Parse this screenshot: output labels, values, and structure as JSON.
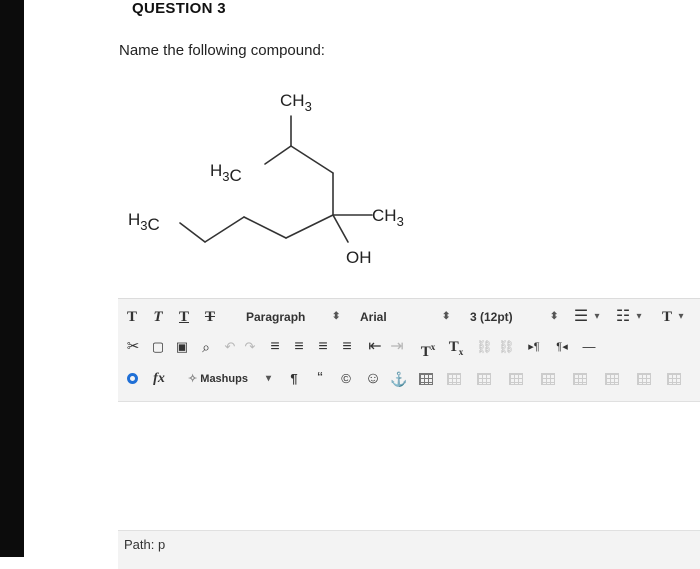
{
  "question": {
    "title": "QUESTION 3",
    "prompt": "Name the following compound:"
  },
  "structure": {
    "labels": {
      "top_ch3": "CH3",
      "h3c_mid": "H3C",
      "h3c_left": "H3C",
      "ch3_right": "CH3",
      "oh": "OH"
    }
  },
  "toolbar": {
    "row1": {
      "format_t1": "T",
      "format_t2": "T",
      "format_t3": "T",
      "format_t4": "T",
      "paragraph_label": "Paragraph",
      "font_label": "Arial",
      "size_label": "3 (12pt)",
      "more_t": "T"
    },
    "row2": {
      "superscript": "T",
      "subscript": "T",
      "ltr": "▸¶",
      "rtl": "¶◂"
    },
    "row3": {
      "fx": "fx",
      "mashups_label": "Mashups",
      "pilcrow": "¶",
      "quote": "“",
      "copyright": "©",
      "smiley": "☺",
      "anchor": "⚓"
    }
  },
  "status": {
    "path_label": "Path:",
    "path_value": "p"
  },
  "colors": {
    "accent_blue": "#1f6fd6",
    "toolbar_bg": "#f3f3f3"
  }
}
